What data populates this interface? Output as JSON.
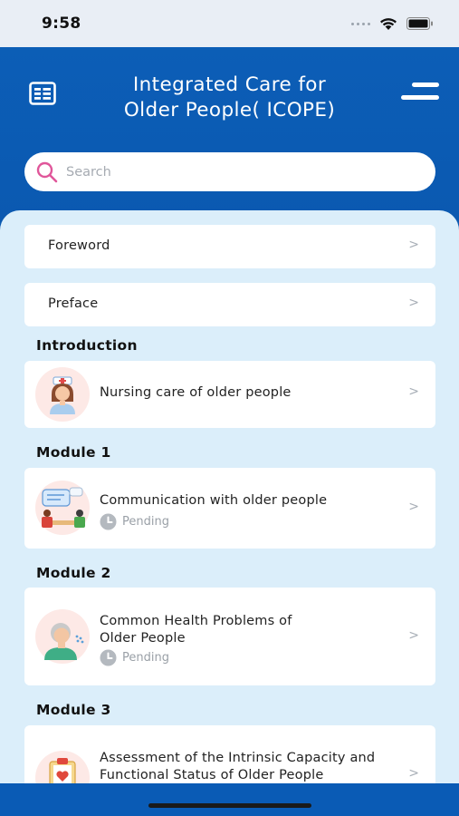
{
  "status_bar": {
    "time": "9:58"
  },
  "header": {
    "title": "Integrated Care for\nOlder People( ICOPE)",
    "menu_icon": "document-list-icon",
    "hamburger_icon": "hamburger-menu-icon"
  },
  "search": {
    "placeholder": "Search",
    "value": "",
    "icon": "search-icon"
  },
  "items": {
    "foreword": {
      "label": "Foreword"
    },
    "preface": {
      "label": "Preface"
    }
  },
  "sections": [
    {
      "title": "Introduction"
    },
    {
      "title": "Module 1"
    },
    {
      "title": "Module 2"
    },
    {
      "title": "Module 3"
    }
  ],
  "modules": [
    {
      "label": "Nursing care of older people",
      "icon": "nurse-icon"
    },
    {
      "label": "Communication with older people",
      "status": "Pending",
      "icon": "communication-icon"
    },
    {
      "label": "Common Health Problems of\nOlder People",
      "status": "Pending",
      "icon": "elderly-patient-icon"
    },
    {
      "label": "Assessment of the Intrinsic Capacity and\nFunctional Status of Older People",
      "icon": "assessment-clipboard-icon"
    }
  ],
  "chevron": ">",
  "colors": {
    "primary": "#0a5bb5",
    "content_bg": "#dbeefa",
    "search_icon": "#e0569a",
    "pending": "#9aa0a7"
  }
}
